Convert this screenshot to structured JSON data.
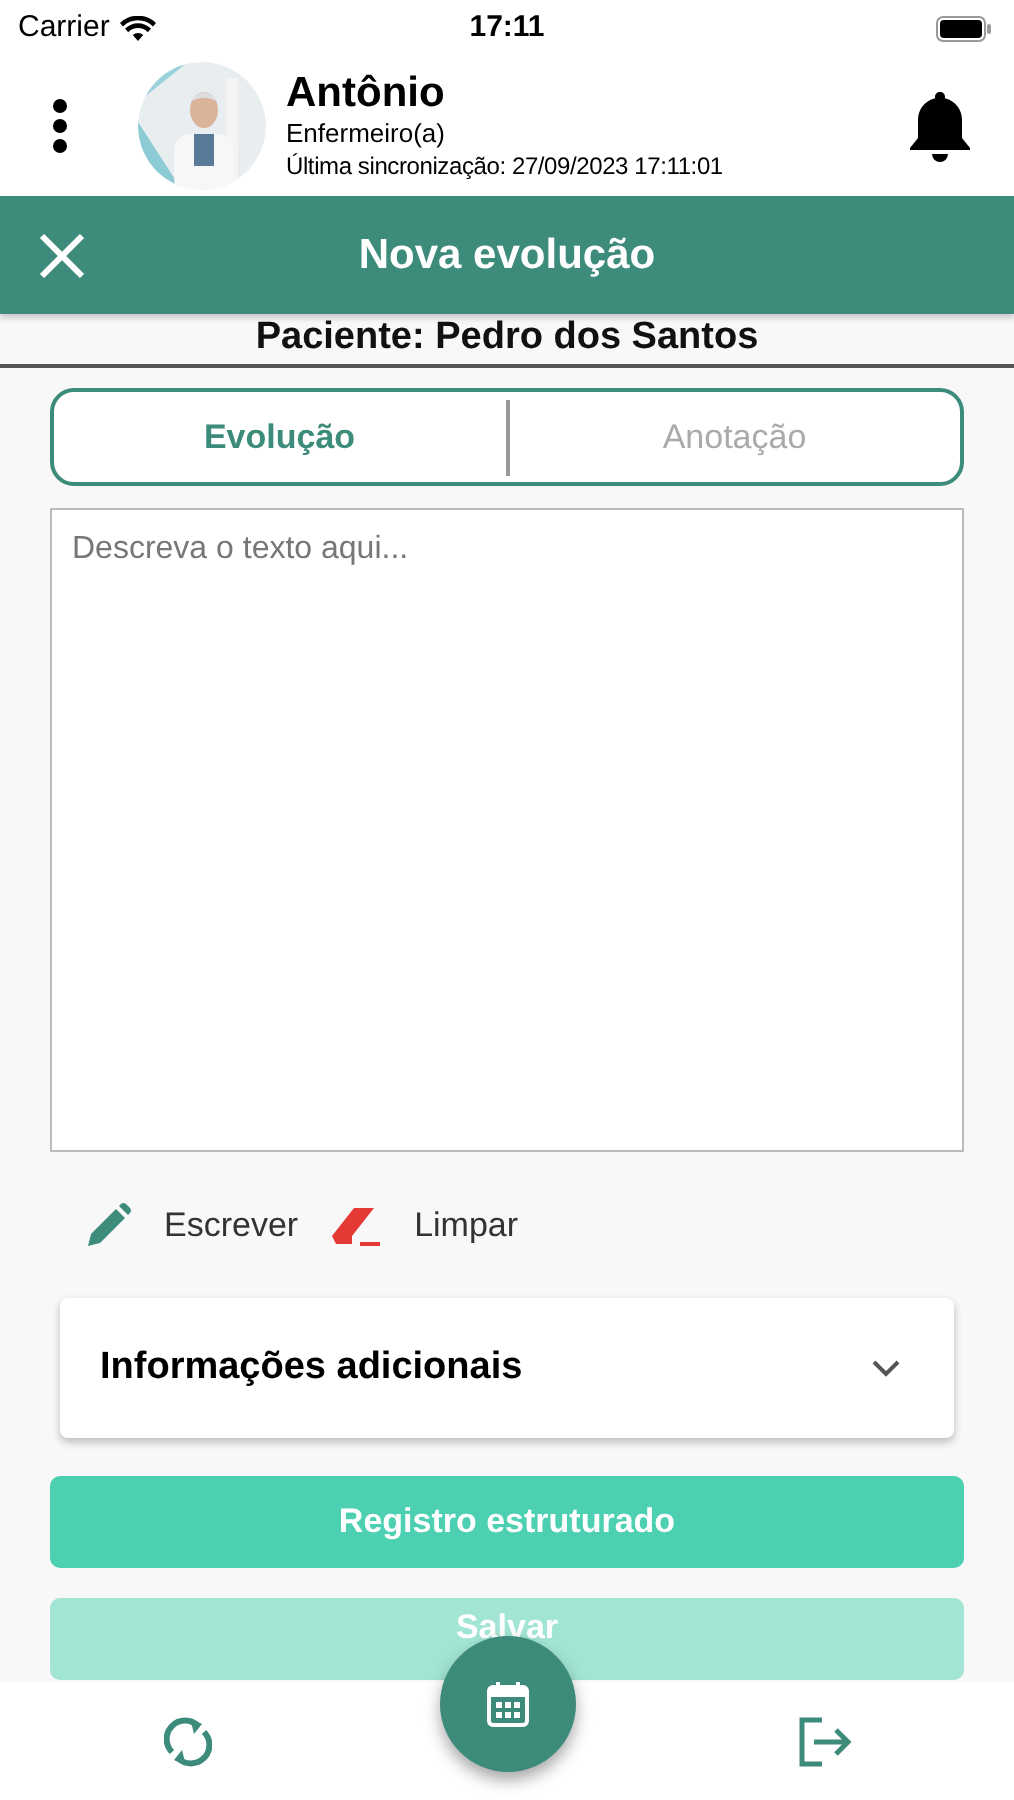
{
  "status_bar": {
    "carrier": "Carrier",
    "time": "17:11"
  },
  "header": {
    "name": "Antônio",
    "role": "Enfermeiro(a)",
    "sync": "Última sincronização: 27/09/2023 17:11:01"
  },
  "title_bar": {
    "title": "Nova evolução"
  },
  "patient": "Paciente: Pedro dos Santos",
  "tabs": [
    {
      "label": "Evolução",
      "selected": true
    },
    {
      "label": "Anotação",
      "selected": false
    }
  ],
  "text_area": {
    "placeholder": "Descreva o texto aqui..."
  },
  "actions": [
    {
      "kind": "write",
      "label": "Escrever"
    },
    {
      "kind": "clear",
      "label": "Limpar"
    }
  ],
  "accordion": {
    "title": "Informações adicionais",
    "expanded": false
  },
  "buttons": [
    {
      "label": "Registro estruturado",
      "disabled": false
    },
    {
      "label": "Salvar",
      "disabled": true
    }
  ]
}
